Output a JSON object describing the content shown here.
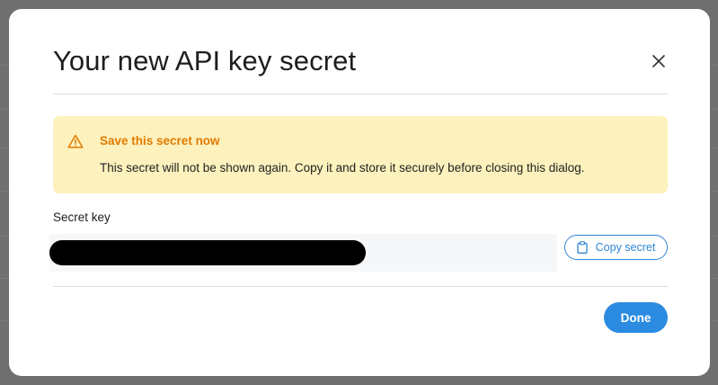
{
  "dialog": {
    "title": "Your new API key secret",
    "close_icon": "close-icon"
  },
  "alert": {
    "icon": "warning-icon",
    "title": "Save this secret now",
    "message": "This secret will not be shown again. Copy it and store it securely before closing this dialog.",
    "background_color": "#fdf1bd",
    "title_color": "#e07b00"
  },
  "secret": {
    "label": "Secret key",
    "value_state": "redacted",
    "copy_button_label": "Copy secret",
    "copy_icon": "clipboard-icon"
  },
  "footer": {
    "done_label": "Done"
  },
  "colors": {
    "accent": "#2b8be0"
  }
}
